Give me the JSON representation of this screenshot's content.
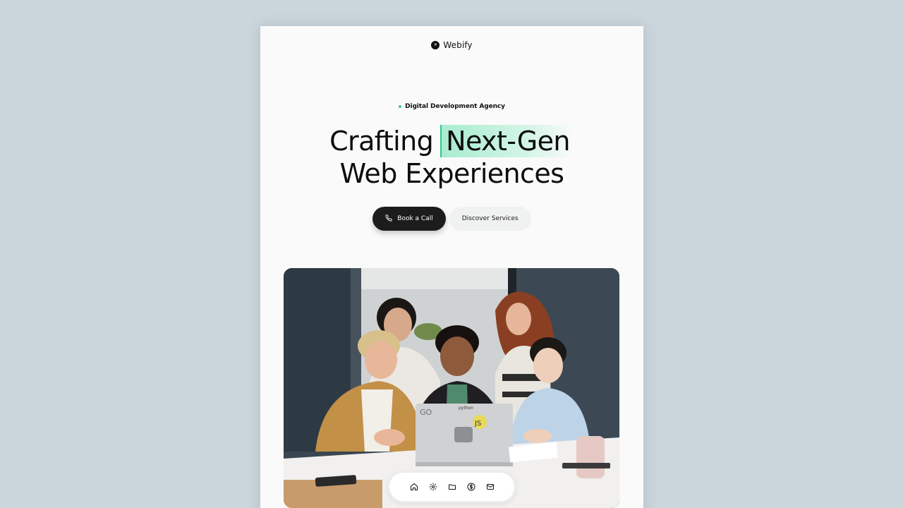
{
  "brand": {
    "name": "Webify"
  },
  "hero": {
    "tagline": "Digital Development Agency",
    "headline_prefix": "Crafting",
    "headline_highlight": "Next-Gen",
    "headline_line2": "Web Experiences",
    "accent_color": "#3fc495"
  },
  "cta": {
    "primary_label": "Book a Call",
    "primary_icon": "phone-icon",
    "secondary_label": "Discover Services"
  },
  "image": {
    "sticker_go": "GO",
    "sticker_python": "python",
    "sticker_js": "JS"
  },
  "dock": {
    "items": [
      {
        "icon": "home-icon"
      },
      {
        "icon": "gear-icon"
      },
      {
        "icon": "folder-icon"
      },
      {
        "icon": "dollar-icon"
      },
      {
        "icon": "mail-icon"
      }
    ]
  }
}
